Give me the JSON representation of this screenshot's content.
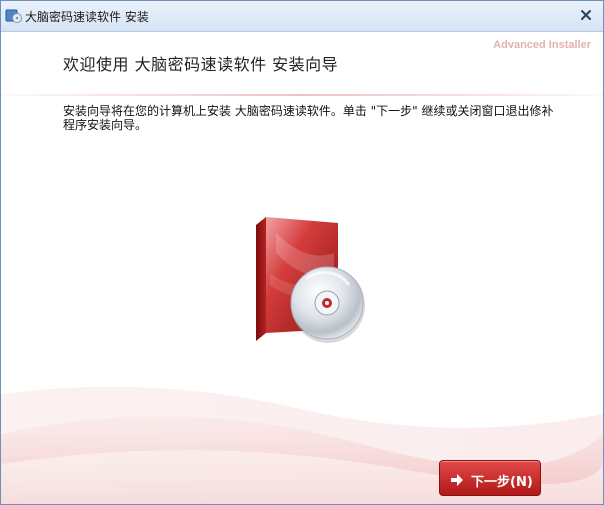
{
  "window": {
    "title": "大脑密码速读软件 安装",
    "brand": "Advanced Installer"
  },
  "wizard": {
    "heading": "欢迎使用  大脑密码速读软件  安装向导",
    "intro": "安装向导将在您的计算机上安装  大脑密码速读软件。单击 \"下一步\" 继续或关闭窗口退出修补程序安装向导。",
    "next_label": "下一步(N)"
  },
  "colors": {
    "accent": "#c62828",
    "title_bar": "#d6e4f4",
    "brand": "#e3b1b1"
  },
  "icons": {
    "title": "installer-icon",
    "close": "close-icon",
    "product": "software-box-cd-icon",
    "next": "arrow-right-icon"
  }
}
